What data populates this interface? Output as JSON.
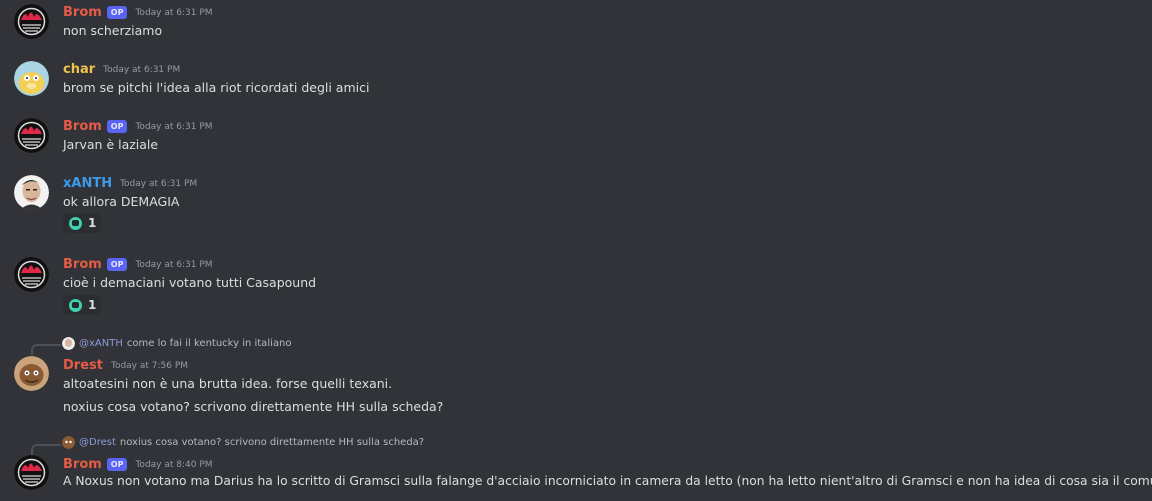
{
  "colors": {
    "brom": "#e65b48",
    "char": "#f0c14b",
    "xanth": "#3d9be9",
    "drest": "#e65b48"
  },
  "messages": [
    {
      "user": "Brom",
      "op": "OP",
      "time": "Today at 6:31 PM",
      "text": "non scherziamo"
    },
    {
      "user": "char",
      "time": "Today at 6:31 PM",
      "text": "brom se pitchi l'idea alla riot ricordati degli amici"
    },
    {
      "user": "Brom",
      "op": "OP",
      "time": "Today at 6:31 PM",
      "text": "Jarvan è laziale"
    },
    {
      "user": "xANTH",
      "time": "Today at 6:31 PM",
      "text": "ok allora DEMAGIA",
      "reaction": {
        "icon": "teal-face-emoji",
        "count": "1"
      }
    },
    {
      "user": "Brom",
      "op": "OP",
      "time": "Today at 6:31 PM",
      "text": "cioè i demaciani votano tutti Casapound",
      "reaction": {
        "icon": "teal-face-emoji",
        "count": "1"
      }
    },
    {
      "reply": {
        "mention": "@xANTH",
        "text": "come lo fai il kentucky in italiano"
      },
      "user": "Drest",
      "time": "Today at 7:56 PM",
      "lines": [
        "altoatesini non è una brutta idea. forse quelli texani.",
        "noxius cosa votano? scrivono direttamente HH sulla scheda?"
      ]
    },
    {
      "reply": {
        "mention": "@Drest",
        "text": "noxius cosa votano? scrivono direttamente HH sulla scheda?"
      },
      "user": "Brom",
      "op": "OP",
      "time": "Today at 8:40 PM",
      "text": "A Noxus non votano ma Darius ha lo scritto di Gramsci sulla falange d'acciaio incorniciato in camera da letto (non ha letto nient'altro di Gramsci e non ha idea di cosa sia il comunismo)"
    }
  ]
}
